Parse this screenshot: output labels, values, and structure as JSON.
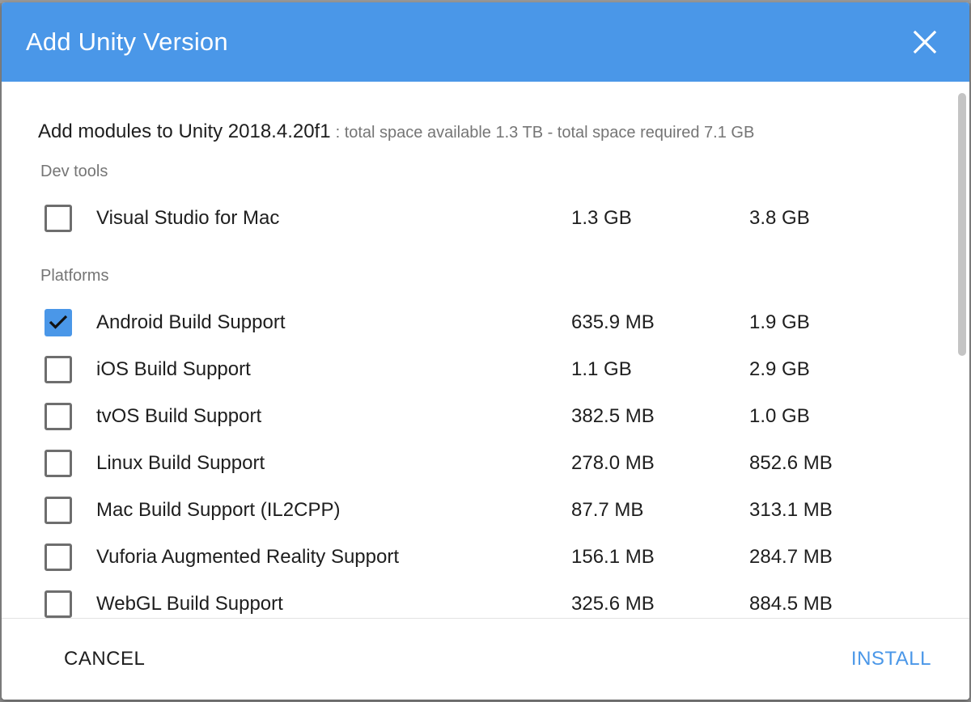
{
  "dialog": {
    "title": "Add Unity Version",
    "close_icon": "close-icon",
    "accent_color": "#4a97e8"
  },
  "intro": {
    "main": "Add modules to Unity 2018.4.20f1",
    "sub": ": total space available 1.3 TB - total space required 7.1 GB"
  },
  "sections": {
    "dev_tools": "Dev tools",
    "platforms": "Platforms"
  },
  "dev_tools": [
    {
      "name": "Visual Studio for Mac",
      "download": "1.3 GB",
      "install": "3.8 GB",
      "checked": false
    }
  ],
  "platforms": [
    {
      "name": "Android Build Support",
      "download": "635.9 MB",
      "install": "1.9 GB",
      "checked": true
    },
    {
      "name": "iOS Build Support",
      "download": "1.1 GB",
      "install": "2.9 GB",
      "checked": false
    },
    {
      "name": "tvOS Build Support",
      "download": "382.5 MB",
      "install": "1.0 GB",
      "checked": false
    },
    {
      "name": "Linux Build Support",
      "download": "278.0 MB",
      "install": "852.6 MB",
      "checked": false
    },
    {
      "name": "Mac Build Support (IL2CPP)",
      "download": "87.7 MB",
      "install": "313.1 MB",
      "checked": false
    },
    {
      "name": "Vuforia Augmented Reality Support",
      "download": "156.1 MB",
      "install": "284.7 MB",
      "checked": false
    },
    {
      "name": "WebGL Build Support",
      "download": "325.6 MB",
      "install": "884.5 MB",
      "checked": false
    }
  ],
  "footer": {
    "cancel_label": "CANCEL",
    "install_label": "INSTALL"
  }
}
